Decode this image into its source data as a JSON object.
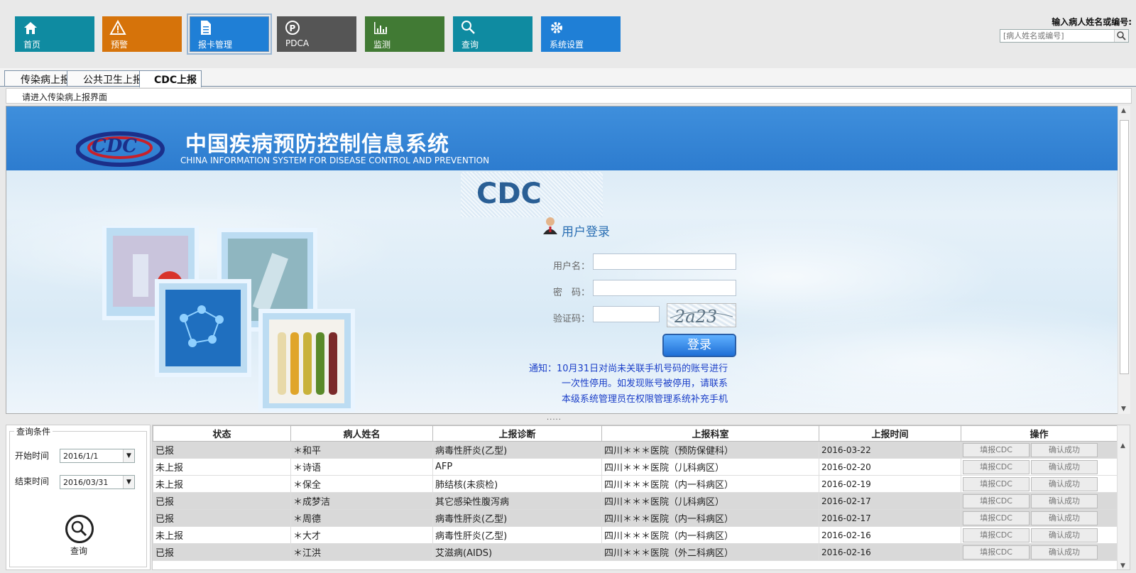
{
  "nav": [
    {
      "label": "首页",
      "icon": "home-icon",
      "color": "#0f8ba1"
    },
    {
      "label": "预警",
      "icon": "warning-icon",
      "color": "#d6730a"
    },
    {
      "label": "报卡管理",
      "icon": "document-icon",
      "color": "#1f7fd6"
    },
    {
      "label": "PDCA",
      "icon": "pdca-icon",
      "color": "#555555"
    },
    {
      "label": "监测",
      "icon": "chart-icon",
      "color": "#417a34"
    },
    {
      "label": "查询",
      "icon": "search-icon",
      "color": "#0f8ba1"
    },
    {
      "label": "系统设置",
      "icon": "gear-icon",
      "color": "#1f7fd6"
    }
  ],
  "search": {
    "label": "输入病人姓名或编号:",
    "placeholder": "[病人姓名或编号]"
  },
  "tabs": [
    "传染病上报",
    "公共卫生上报",
    "CDC上报"
  ],
  "breadcrumb": "请进入传染病上报界面",
  "cdc": {
    "title_cn": "中国疾病预防控制信息系统",
    "title_en": "CHINA INFORMATION SYSTEM FOR DISEASE CONTROL AND PREVENTION",
    "big_logo": "CDC",
    "login_title": "用户登录",
    "username_label": "用户名：",
    "password_label": "密　码：",
    "captcha_label": "验证码：",
    "captcha_text": "2a23",
    "login_button": "登录",
    "notice_lines": [
      "通知：10月31日对尚未关联手机号码的账号进行",
      "一次性停用。如发现账号被停用，请联系",
      "本级系统管理员在权限管理系统补充手机"
    ]
  },
  "splitter": ".....",
  "query": {
    "legend": "查询条件",
    "start_label": "开始时间",
    "start_value": "2016/1/1",
    "end_label": "结束时间",
    "end_value": "2016/03/31",
    "button": "查询"
  },
  "grid": {
    "headers": [
      "状态",
      "病人姓名",
      "上报诊断",
      "上报科室",
      "上报时间",
      "操作"
    ],
    "op_fill": "填报CDC",
    "op_confirm": "确认成功",
    "rows": [
      {
        "status": "已报",
        "name": "＊和平",
        "diagnosis": "病毒性肝炎(乙型)",
        "dept": "四川＊＊＊医院（预防保健科）",
        "time": "2016-03-22"
      },
      {
        "status": "未上报",
        "name": "＊诗语",
        "diagnosis": "AFP",
        "dept": "四川＊＊＊医院（儿科病区）",
        "time": "2016-02-20"
      },
      {
        "status": "未上报",
        "name": "＊保全",
        "diagnosis": "肺结核(未痰检)",
        "dept": "四川＊＊＊医院（内一科病区）",
        "time": "2016-02-19"
      },
      {
        "status": "已报",
        "name": "＊成梦洁",
        "diagnosis": "其它感染性腹泻病",
        "dept": "四川＊＊＊医院（儿科病区）",
        "time": "2016-02-17"
      },
      {
        "status": "已报",
        "name": "＊周德",
        "diagnosis": "病毒性肝炎(乙型)",
        "dept": "四川＊＊＊医院（内一科病区）",
        "time": "2016-02-17"
      },
      {
        "status": "未上报",
        "name": "＊大才",
        "diagnosis": "病毒性肝炎(乙型)",
        "dept": "四川＊＊＊医院（内一科病区）",
        "time": "2016-02-16"
      },
      {
        "status": "已报",
        "name": "＊江洪",
        "diagnosis": "艾滋病(AIDS)",
        "dept": "四川＊＊＊医院（外二科病区）",
        "time": "2016-02-16"
      }
    ]
  }
}
